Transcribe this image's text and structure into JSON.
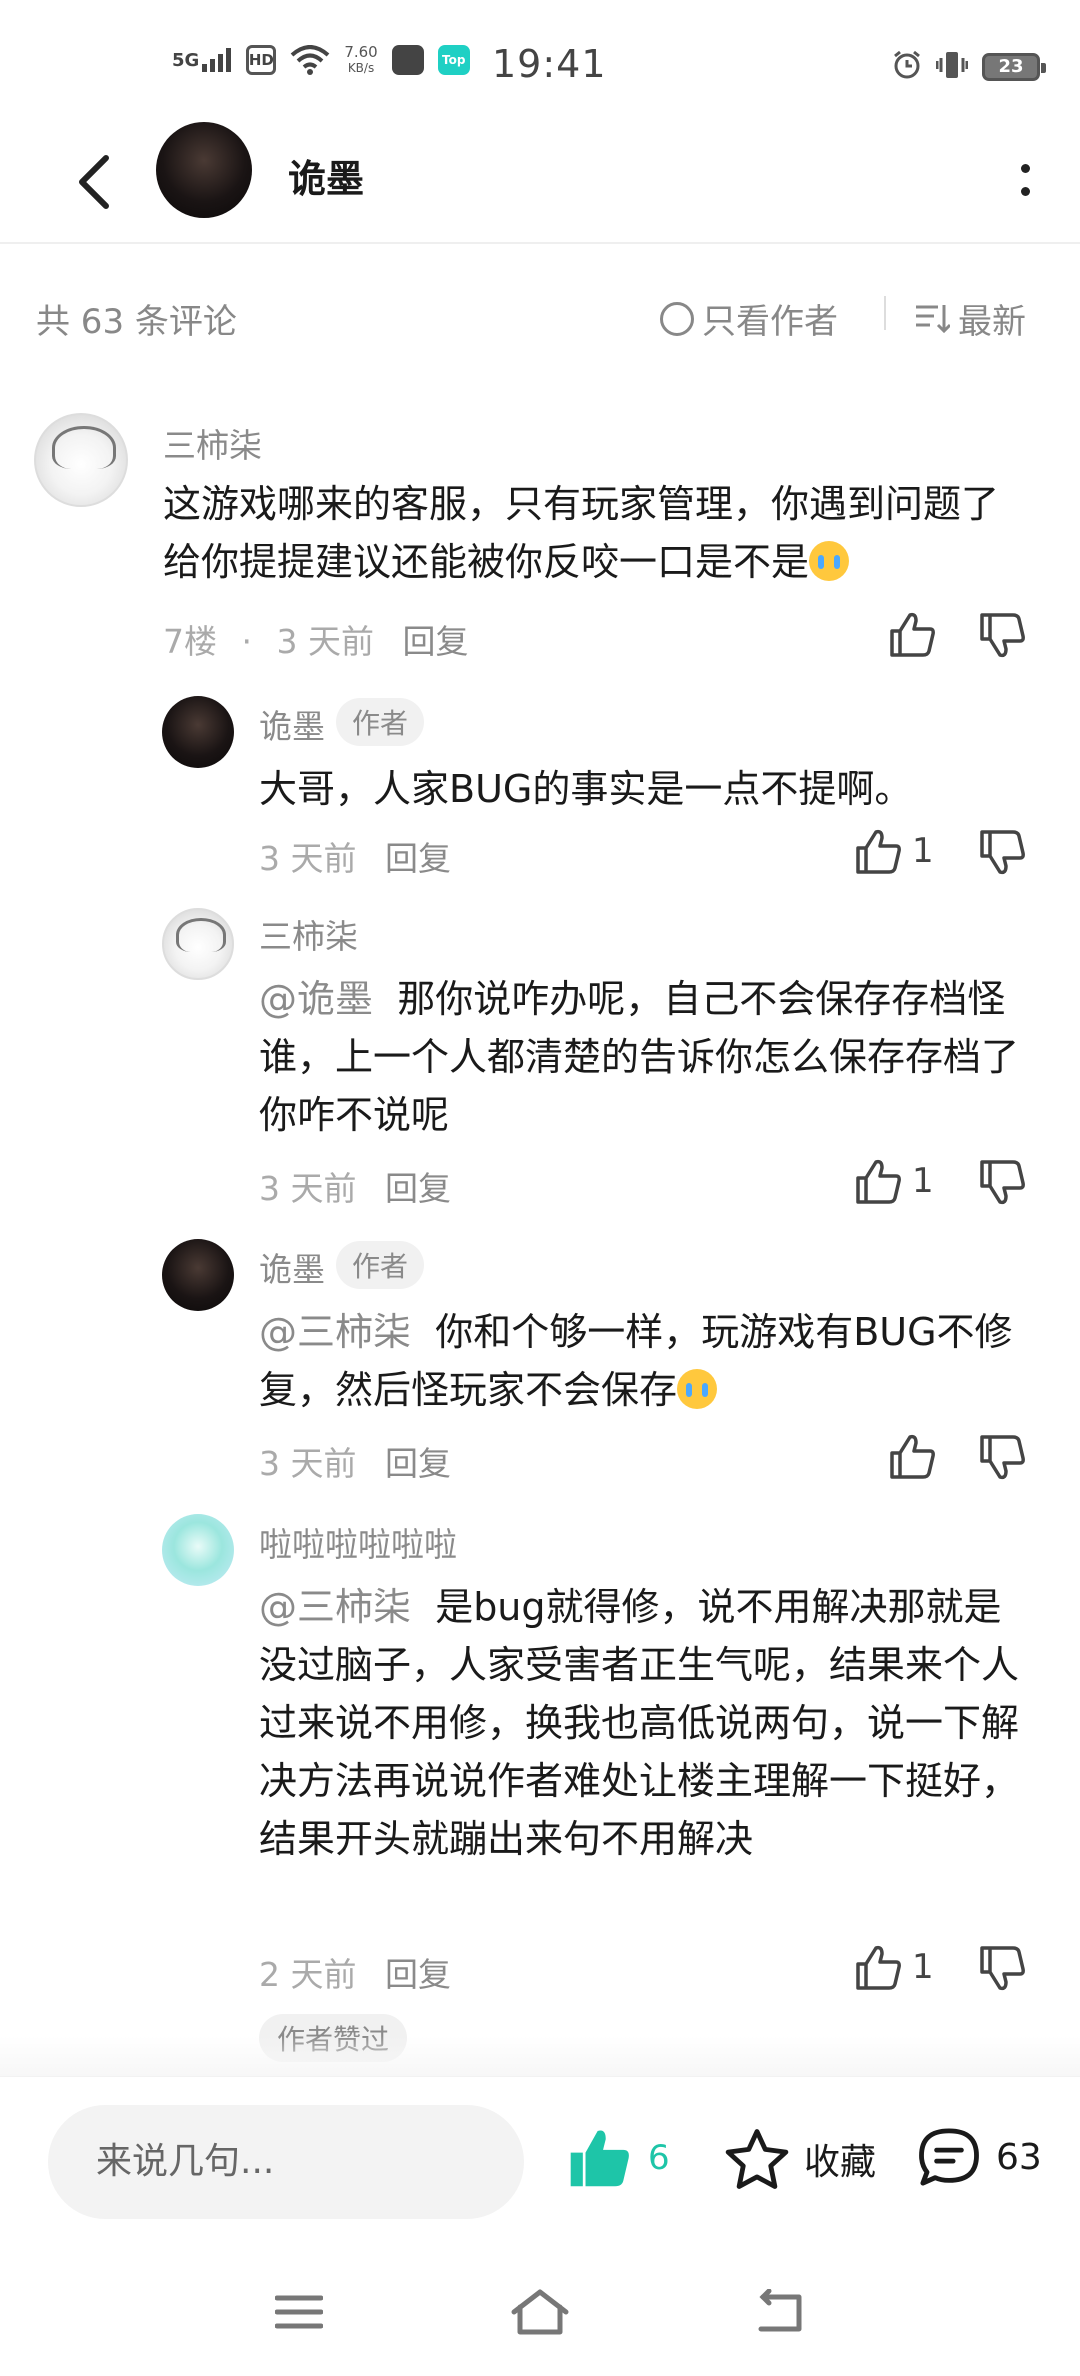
{
  "status_bar": {
    "network": "5G",
    "hd": "HD",
    "speed_value": "7.60",
    "speed_unit": "KB/s",
    "top_app": "Top",
    "time": "19:41",
    "battery": "23"
  },
  "header": {
    "name": "诡墨"
  },
  "toolbar": {
    "count": "共 63 条评论",
    "author_only": "只看作者",
    "sort": "最新"
  },
  "comments": [
    {
      "user": "三柿柒",
      "text": "这游戏哪来的客服，只有玩家管理，你遇到问题了给你提提建议还能被你反咬一口是不是",
      "floor": "7楼",
      "dot": "·",
      "time": "3 天前",
      "reply": "回复",
      "likes": ""
    },
    {
      "user": "诡墨",
      "badge": "作者",
      "text": "大哥，人家BUG的事实是一点不提啊。",
      "time": "3 天前",
      "reply": "回复",
      "likes": "1"
    },
    {
      "user": "三柿柒",
      "mention": "@诡墨",
      "text": "那你说咋办呢，自己不会保存存档怪谁，上一个人都清楚的告诉你怎么保存存档了你咋不说呢",
      "time": "3 天前",
      "reply": "回复",
      "likes": "1"
    },
    {
      "user": "诡墨",
      "badge": "作者",
      "mention": "@三柿柒",
      "text": "你和个够一样，玩游戏有BUG不修复，然后怪玩家不会保存",
      "time": "3 天前",
      "reply": "回复",
      "likes": ""
    },
    {
      "user": "啦啦啦啦啦啦",
      "mention": "@三柿柒",
      "text": "是bug就得修，说不用解决那就是没过脑子，人家受害者正生气呢，结果来个人过来说不用修，换我也高低说两句，说一下解决方法再说说作者难处让楼主理解一下挺好，结果开头就蹦出来句不用解决",
      "time": "2 天前",
      "reply": "回复",
      "likes": "1",
      "liked_badge": "作者赞过"
    }
  ],
  "bottom_bar": {
    "input_placeholder": "来说几句...",
    "like_count": "6",
    "favorite_label": "收藏",
    "comment_count": "63"
  },
  "colors": {
    "accent": "#1ec5a8",
    "text_primary": "#1a1a1a",
    "text_secondary": "#8a8a8a"
  }
}
